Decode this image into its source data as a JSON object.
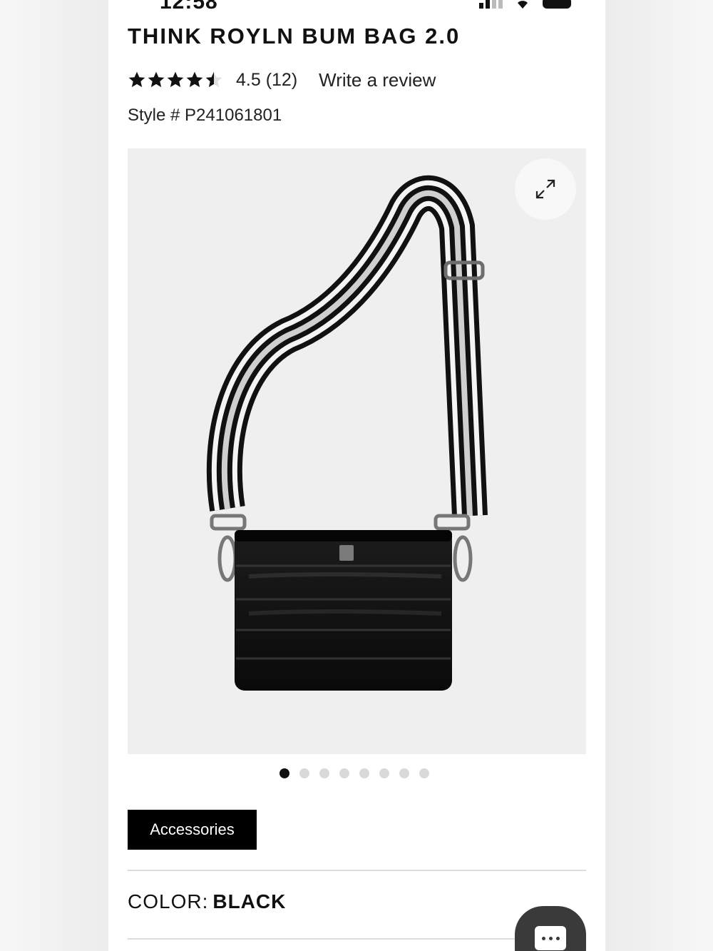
{
  "status_bar": {
    "time": "12:58"
  },
  "product": {
    "title": "THINK ROYLN BUM BAG 2.0",
    "rating": 4.5,
    "rating_text": "4.5 (12)",
    "review_link": "Write a review",
    "style_number": "Style # P241061801"
  },
  "gallery": {
    "total_images": 8,
    "active_index": 0,
    "expand_icon": "expand-arrows-icon"
  },
  "category_tag": "Accessories",
  "color": {
    "label": "COLOR:",
    "value": "BLACK"
  },
  "chat": {
    "icon": "chat-bubble-icon"
  },
  "colors": {
    "accent": "#000000",
    "dot_inactive": "#d9d9d9",
    "chat_bg": "#3a3a3a"
  }
}
